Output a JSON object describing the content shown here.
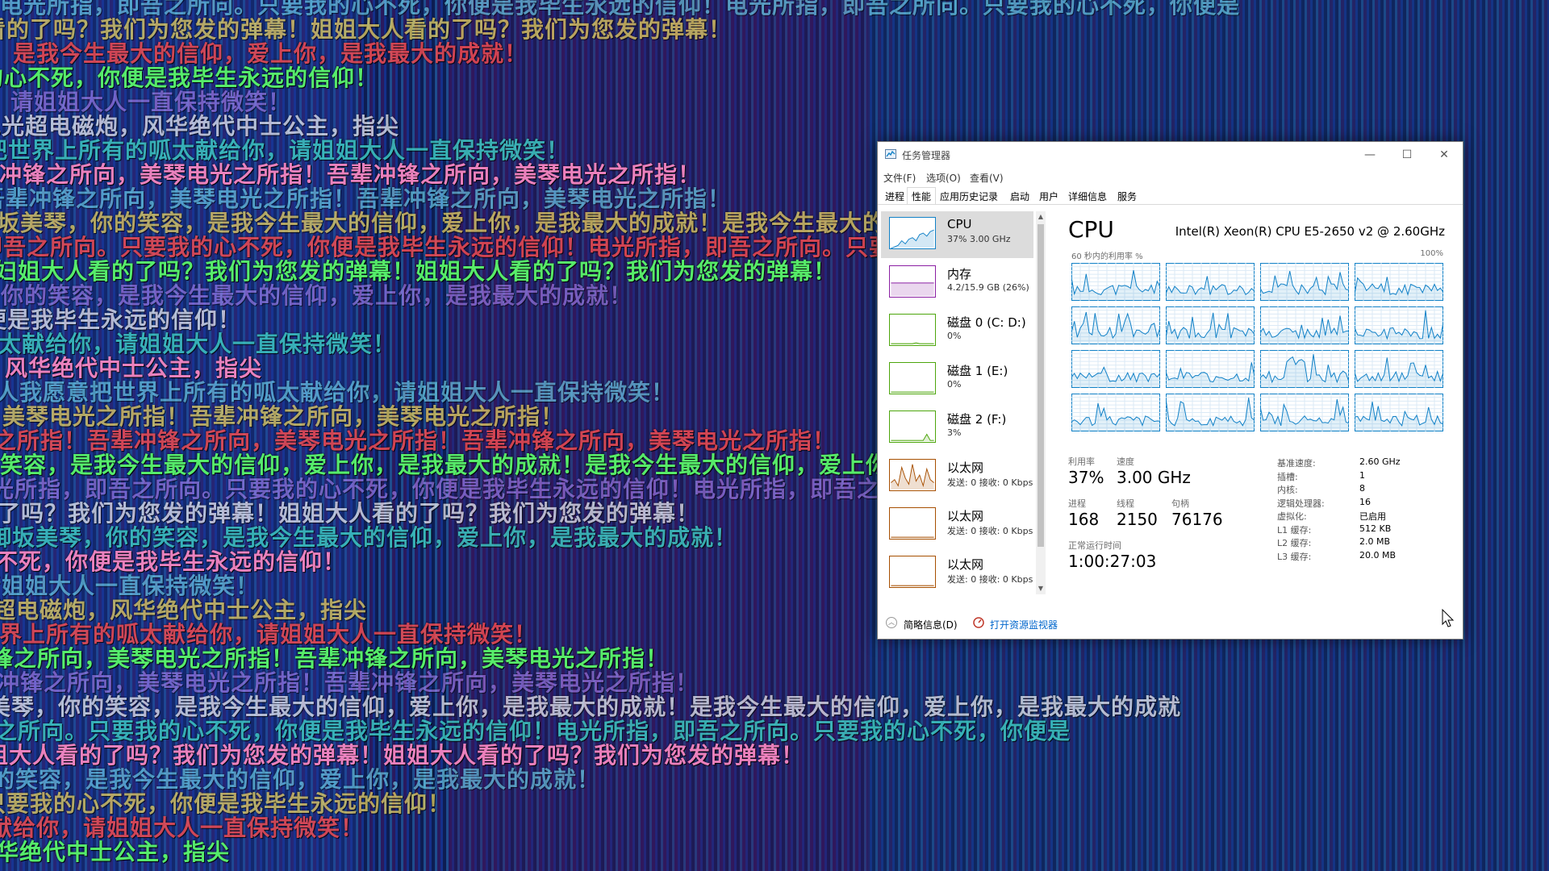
{
  "background": {
    "lines": [
      "电光所指，即吾之所向。只要我的心不死，你便是我毕生永远的信仰！电光所指，即吾之所向。只要我的心不死，你便是",
      "妇姐大人看的了吗？我们为您发的弹幕！姐姐大人看的了吗？我们为您发的弹幕！",
      "御坂美琴，你的笑容，是我今生最大的信仰，爱上你，是我最大的成就！",
      "只要我的心不死，你便是我毕生永远的信仰！",
      "所有的呱太献给你，请姐姐大人一直保持微笑！",
      "美琴电光超电磁炮，风华绝代中士公主，指尖",
      "姐姐大人我愿意把世界上所有的呱太献给你，请姐姐大人一直保持微笑！",
      "吾辈冲锋之所向，美琴电光之所指！吾辈冲锋之所向，美琴电光之所指！",
      "电光之所指！吾辈冲锋之所向，美琴电光之所指！吾辈冲锋之所向，美琴电光之所指！",
      "御坂美琴，你的笑容，是我今生最大的信仰，爱上你，是我最大的成就！是我今生最大的信仰，爱上你，是我最大的成就"
    ]
  },
  "window": {
    "title": "任务管理器",
    "controls": {
      "minimize": "—",
      "maximize": "☐",
      "close": "✕"
    },
    "menu": [
      "文件(F)",
      "选项(O)",
      "查看(V)"
    ],
    "tabs": [
      "进程",
      "性能",
      "应用历史记录",
      "启动",
      "用户",
      "详细信息",
      "服务"
    ],
    "active_tab": "性能"
  },
  "sidebar": {
    "items": [
      {
        "title": "CPU",
        "sub": "37% 3.00 GHz",
        "color": "#1181c7"
      },
      {
        "title": "内存",
        "sub": "4.2/15.9 GB (26%)",
        "color": "#8b1fa3"
      },
      {
        "title": "磁盘 0 (C: D:)",
        "sub": "0%",
        "color": "#4da60c"
      },
      {
        "title": "磁盘 1 (E:)",
        "sub": "0%",
        "color": "#4da60c"
      },
      {
        "title": "磁盘 2 (F:)",
        "sub": "3%",
        "color": "#4da60c"
      },
      {
        "title": "以太网",
        "sub": "发送: 0 接收: 0 Kbps",
        "color": "#a74f01"
      },
      {
        "title": "以太网",
        "sub": "发送: 0 接收: 0 Kbps",
        "color": "#a74f01"
      },
      {
        "title": "以太网",
        "sub": "发送: 0 接收: 0 Kbps",
        "color": "#a74f01"
      }
    ]
  },
  "main": {
    "title": "CPU",
    "model": "Intel(R) Xeon(R) CPU E5-2650 v2 @ 2.60GHz",
    "graph_caption": "60 秒内的利用率 %",
    "graph_max": "100%",
    "stats": {
      "util_label": "利用率",
      "util": "37%",
      "speed_label": "速度",
      "speed": "3.00 GHz",
      "proc_label": "进程",
      "proc": "168",
      "thread_label": "线程",
      "thread": "2150",
      "handle_label": "句柄",
      "handle": "76176",
      "uptime_label": "正常运行时间",
      "uptime": "1:00:27:03"
    },
    "specs": [
      {
        "label": "基准速度:",
        "value": "2.60 GHz"
      },
      {
        "label": "插槽:",
        "value": "1"
      },
      {
        "label": "内核:",
        "value": "8"
      },
      {
        "label": "逻辑处理器:",
        "value": "16"
      },
      {
        "label": "虚拟化:",
        "value": "已启用"
      },
      {
        "label": "L1 缓存:",
        "value": "512 KB"
      },
      {
        "label": "L2 缓存:",
        "value": "2.0 MB"
      },
      {
        "label": "L3 缓存:",
        "value": "20.0 MB"
      }
    ]
  },
  "footer": {
    "fewer_details": "简略信息(D)",
    "resource_monitor": "打开资源监视器"
  },
  "icons": {
    "app": "task-manager-icon",
    "collapse": "chevron-up-icon",
    "resource_monitor": "resource-monitor-icon",
    "cursor": "mouse-cursor-icon"
  }
}
